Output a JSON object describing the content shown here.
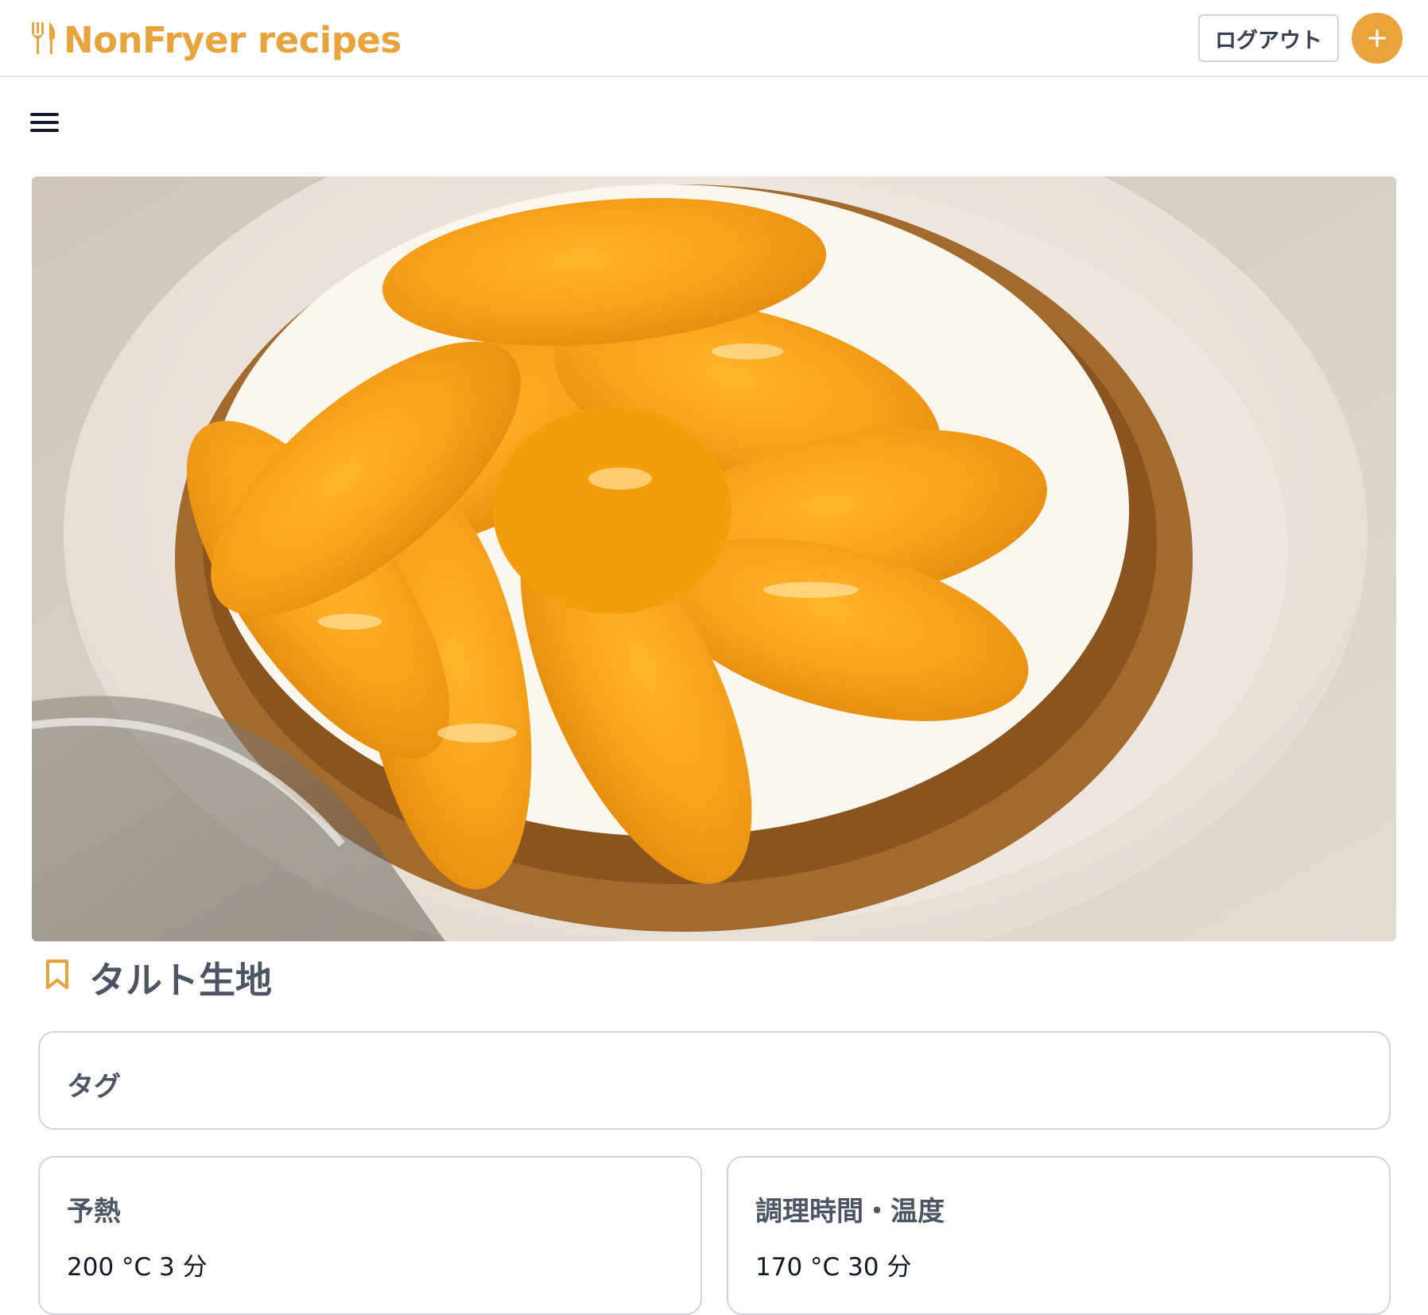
{
  "header": {
    "brand_title": "NonFryer recipes",
    "brand_icon": "utensils-icon",
    "logout_label": "ログアウト",
    "add_icon": "plus-icon"
  },
  "colors": {
    "accent": "#e8a33c",
    "title_text": "#4b5563",
    "border": "#d1d5db"
  },
  "nav": {
    "menu_icon": "hamburger-menu-icon"
  },
  "recipe": {
    "hero_image": "peach tart photo",
    "bookmark_icon": "bookmark-icon",
    "title": "タルト生地",
    "tags_label": "タグ",
    "preheat": {
      "label": "予熱",
      "value": "200 °C 3 分"
    },
    "cook": {
      "label": "調理時間・温度",
      "value": "170 °C 30 分"
    }
  }
}
